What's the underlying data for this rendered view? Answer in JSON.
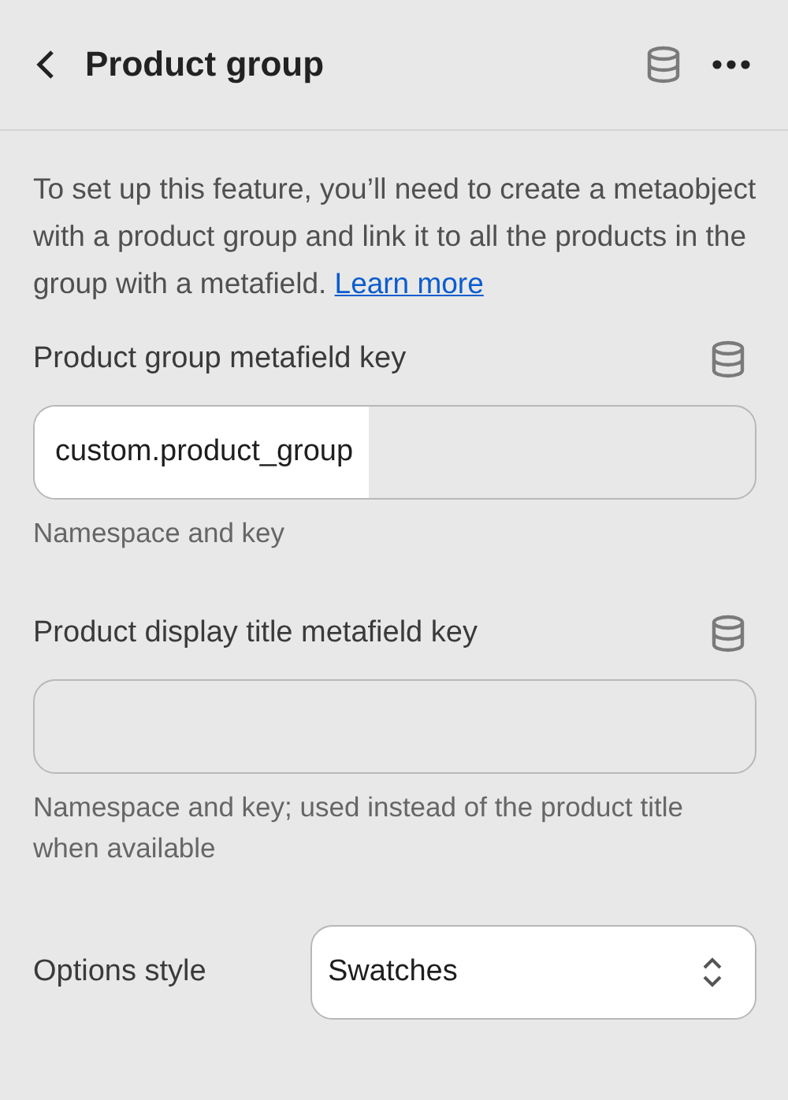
{
  "header": {
    "title": "Product group"
  },
  "description": {
    "text": "To set up this feature, you’ll need to create a metaobject with a product group and link it to all the products in the group with a metafield.",
    "link": "Learn more"
  },
  "fields": [
    {
      "kind": "text",
      "label": "Product group metafield key",
      "value": "custom.product_group",
      "help": "Namespace and key"
    },
    {
      "kind": "text",
      "label": "Product display title metafield key",
      "help": "Namespace and key; used instead of the product title when available"
    },
    {
      "kind": "select",
      "label": "Options style",
      "value": "Swatches"
    }
  ]
}
